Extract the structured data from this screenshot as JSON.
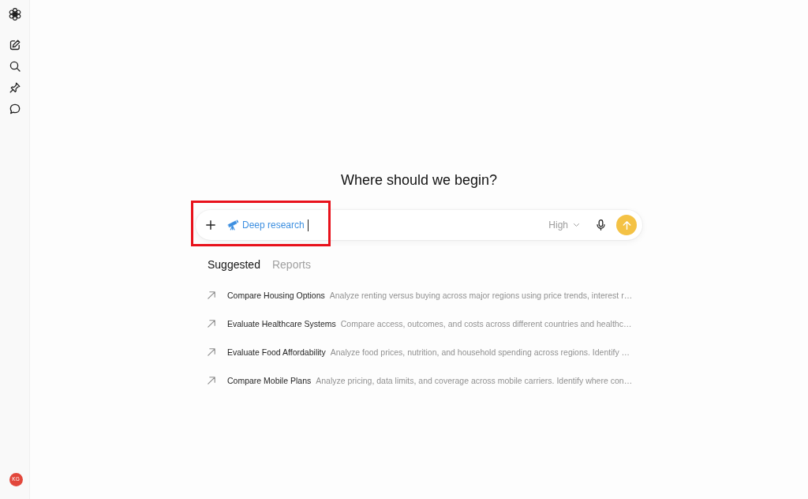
{
  "sidebar": {
    "avatar": {
      "initials": "KG"
    }
  },
  "heading": "Where should we begin?",
  "composer": {
    "tool": {
      "label": "Deep research",
      "highlighted": true
    },
    "effort": {
      "label": "High"
    }
  },
  "tabs": [
    {
      "label": "Suggested",
      "selected": true
    },
    {
      "label": "Reports",
      "selected": false
    }
  ],
  "suggestions": [
    {
      "title": "Compare Housing Options",
      "description": "Analyze renting versus buying across major regions using price trends, interest r…"
    },
    {
      "title": "Evaluate Healthcare Systems",
      "description": "Compare access, outcomes, and costs across different countries and healthc…"
    },
    {
      "title": "Evaluate Food Affordability",
      "description": "Analyze food prices, nutrition, and household spending across regions. Identify …"
    },
    {
      "title": "Compare Mobile Plans",
      "description": "Analyze pricing, data limits, and coverage across mobile carriers. Identify where con…"
    }
  ]
}
